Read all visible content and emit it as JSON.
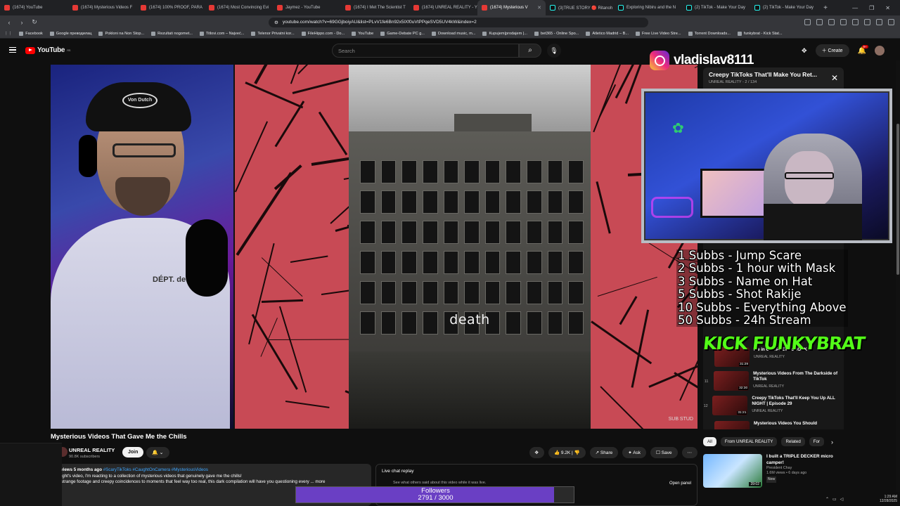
{
  "browser": {
    "tabs": [
      {
        "label": "(1674) YouTube",
        "type": "yt"
      },
      {
        "label": "(1674) Mysterious Videos F",
        "type": "yt"
      },
      {
        "label": "(1674) 100% PROOF, PARA",
        "type": "yt"
      },
      {
        "label": "(1674) Most Convincing Evi",
        "type": "yt"
      },
      {
        "label": "Jaymez - YouTube",
        "type": "yt"
      },
      {
        "label": "(1674) I Met The Scientist T",
        "type": "yt"
      },
      {
        "label": "(1674) UNREAL REALITY - Y",
        "type": "yt"
      },
      {
        "label": "(1674) Mysterious V",
        "type": "yt",
        "active": true
      },
      {
        "label": "(3)TRUE STORY 🔴 Ritanoh",
        "type": "tt"
      },
      {
        "label": "Exploring Nibiru and the N",
        "type": "tt"
      },
      {
        "label": "(2) TikTok - Make Your Day",
        "type": "tt"
      },
      {
        "label": "(2) TikTok - Make Your Day",
        "type": "tt"
      }
    ],
    "new_tab": "+",
    "url": "youtube.com/watch?v=69GGjboiyAU&list=PLvV1fe6Bn92x5lXf0uVtPPqeSVD5UV4kW&index=2",
    "bookmarks": [
      "Facebook",
      "Google преводилац",
      "Pokloni na Non Stop...",
      "Rezultati nogomet...",
      "Titlovi.com – Najveć...",
      "Telenor Privatni kor...",
      "FileHippo.com - Do...",
      "YouTube",
      "Game-Debate PC g...",
      "Download music, m...",
      "Kupujem|prodajem |...",
      "bet365 - Online Spo...",
      "Atletico Madrid – B...",
      "Free Live Video Stre...",
      "Torrent Downloads...",
      "funkybrat - Kick Stat..."
    ]
  },
  "header": {
    "logo": "YouTube",
    "logo_sup": "RS",
    "search_placeholder": "Search",
    "create_label": "Create",
    "notif_count": "9+"
  },
  "video": {
    "caption": "death",
    "shirt_text": "DÉPT. de GALERIE",
    "cap_text": "Von Dutch",
    "corner": "SUB STUD"
  },
  "overlay": {
    "instagram_handle": "vladislav8111",
    "subs_goals": [
      "1 Subbs - Jump Scare",
      "2 Subbs - 1 hour with Mask",
      "3 Subbs - Name on Hat",
      "5 Subbs - Shot Rakije",
      "10 Subbs - Everything Above",
      "50 Subbs - 24h Stream"
    ],
    "kick_logo": "KICK FUNKYBRAT",
    "followers_label": "Followers",
    "followers_count": "2791 / 3000",
    "followers_progress": 0.93
  },
  "playlist": {
    "title": "Creepy TikToks That'll Make You Ret...",
    "channel": "UNREAL REALITY",
    "position": "2 / 134",
    "items": [
      {
        "num": "",
        "title": "Me in COMPLETE SHOCK",
        "channel": "UNREAL REALITY",
        "duration": "31:29"
      },
      {
        "num": "11",
        "title": "Mysterious Videos From The Darkside of TikTok",
        "channel": "UNREAL REALITY",
        "duration": "32:30"
      },
      {
        "num": "12",
        "title": "Creepy TikToks That'll Keep You Up ALL NIGHT | Episode 29",
        "channel": "UNREAL REALITY",
        "duration": "31:21"
      },
      {
        "num": "13",
        "title": "Mysterious Videos You Should",
        "channel": "",
        "duration": ""
      }
    ]
  },
  "meta": {
    "title": "Mysterious Videos That Gave Me the Chills",
    "channel_name": "UNREAL REALITY",
    "channel_subs": "90.8K subscribers",
    "join": "Join",
    "bell": "🔔 ⌄",
    "likes": "9.2K",
    "share": "Share",
    "ask": "Ask",
    "save": "Save",
    "desc_stats": "K views  5 months ago",
    "desc_tags": "#ScaryTikToks #CaughtOnCamera #MysteriousVideos",
    "desc_line1": "onight's video, I'm reacting to a collection of mysterious videos that genuinely gave me the chills!",
    "desc_line2": "m strange footage and creepy coincidences to moments that feel way too real, this dark compilation will have you questioning every ... more",
    "livechat_title": "Live chat replay",
    "livechat_sub": "See what others said about this video while it was live.",
    "open_panel": "Open panel"
  },
  "chips": [
    "All",
    "From UNREAL REALITY",
    "Related",
    "For"
  ],
  "rec": {
    "title": "I built a TRIPLE DECKER micro camper!",
    "channel": "President Chay",
    "stats": "1.6M views • 6 days ago",
    "badge": "New",
    "duration": "39:02"
  },
  "taskbar": {
    "time": "1:29 AM",
    "date": "12/28/2025"
  }
}
